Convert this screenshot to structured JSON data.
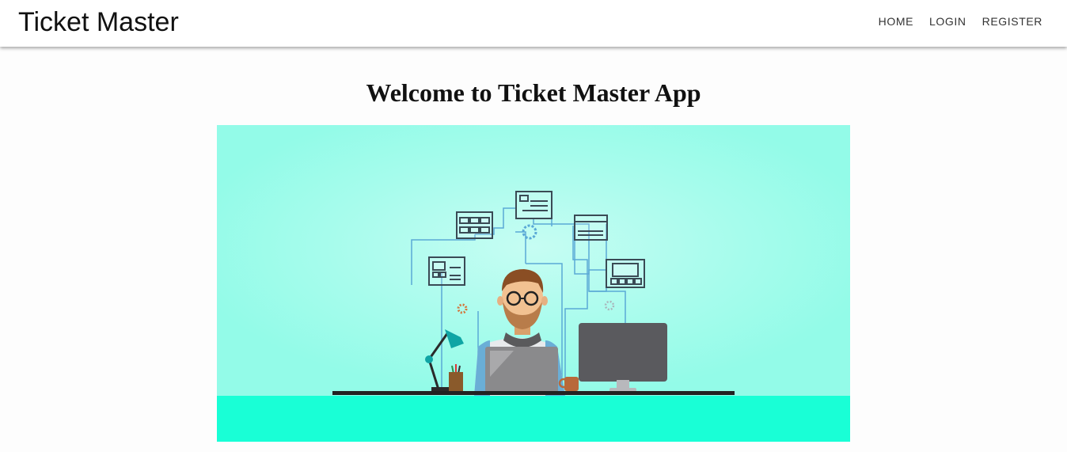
{
  "navbar": {
    "brand": "Ticket Master",
    "links": [
      {
        "label": "HOME"
      },
      {
        "label": "LOGIN"
      },
      {
        "label": "REGISTER"
      }
    ]
  },
  "main": {
    "heading": "Welcome to Ticket Master App",
    "hero_image": "developer-at-desk-illustration"
  },
  "colors": {
    "hero_background": "#98fbea",
    "floor": "#19ffd6",
    "desk": "#222222",
    "monitor": "#58585c",
    "laptop": "#8a8a8c"
  }
}
